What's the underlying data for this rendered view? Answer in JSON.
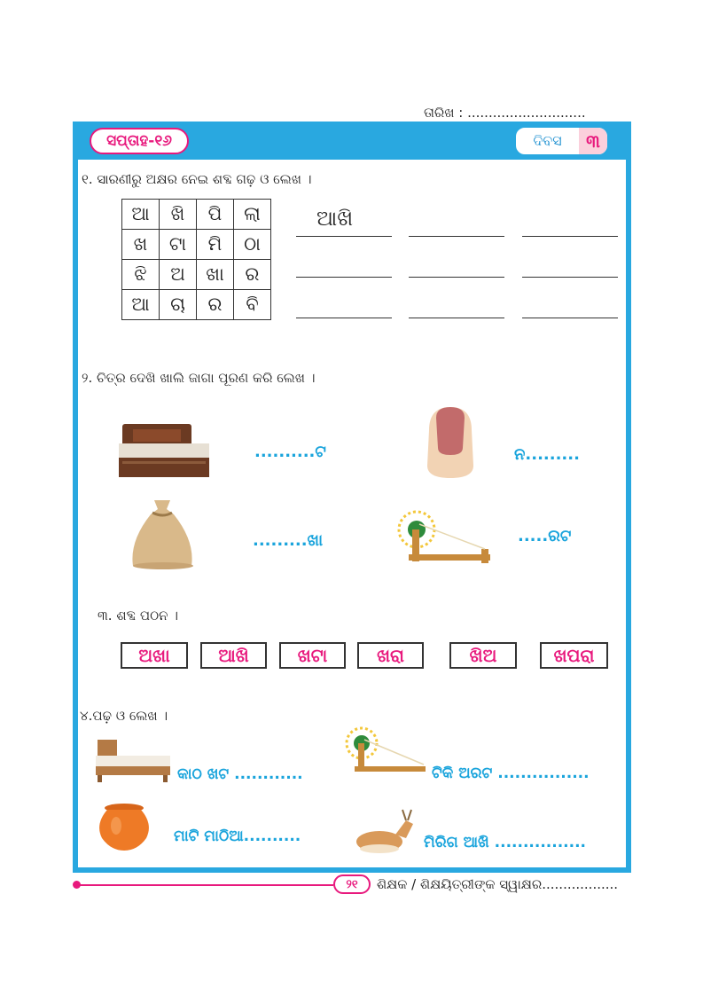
{
  "header": {
    "date_label": "ତାରିଖ : ............................",
    "week_label": "ସପ୍ତାହ-୧୬",
    "day_label": "ଦିବସ",
    "day_number": "୩"
  },
  "section1": {
    "instruction": "୧. ସାରଣୀରୁ ଅକ୍ଷର ନେଇ ଶବ୍ଦ ଗଢ଼ ଓ ଲେଖ ।",
    "grid": [
      [
        "ଆ",
        "ଖି",
        "ପି",
        "ଲା"
      ],
      [
        "ଖ",
        "ଟା",
        "ମି",
        "ଠା"
      ],
      [
        "ଝି",
        "ଅ",
        "ଖା",
        "ର"
      ],
      [
        "ଆ",
        "ଚା",
        "ର",
        "ବି"
      ]
    ],
    "example_answer": "ଆଖି"
  },
  "section2": {
    "instruction": "୨. ଚିତ୍ର ଦେଖି ଖାଲି ଜାଗା ପୂରଣ କରି ଲେଖ ।",
    "items": [
      {
        "icon": "bed-icon",
        "text": "..........ଟ"
      },
      {
        "icon": "fingernail-icon",
        "text": "ନ........."
      },
      {
        "icon": "sack-icon",
        "text": ".........ଖା"
      },
      {
        "icon": "spinning-wheel-icon",
        "text": ".....ରଟ"
      }
    ]
  },
  "section3": {
    "instruction": "୩. ଶବ୍ଦ ପଠନ ।",
    "words": [
      "ଅଖା",
      "ଆଖି",
      "ଖଟା",
      "ଖରା",
      "ଖିଅ",
      "ଖପରା"
    ]
  },
  "section4": {
    "instruction": "୪.ପଢ଼ ଓ ଲେଖ ।",
    "items": [
      {
        "icon": "bed-icon",
        "text": "କାଠ ଖଟ ............"
      },
      {
        "icon": "spinning-wheel-icon",
        "text": "ଟିକି ଅରଟ ................"
      },
      {
        "icon": "clay-pot-icon",
        "text": "ମାଟି ମାଠିଆ.........."
      },
      {
        "icon": "deer-icon",
        "text": "ମିରିଗ ଆଖି ................"
      }
    ]
  },
  "footer": {
    "page_number": "୨୧",
    "signature_label": "ଶିକ୍ଷକ / ଶିକ୍ଷୟିତ୍ରୀଙ୍କ ସ୍ୱାକ୍ଷର.................."
  },
  "colors": {
    "accent_blue": "#29a8e0",
    "accent_pink": "#e8197d",
    "fill_text": "#1aa4dc"
  }
}
